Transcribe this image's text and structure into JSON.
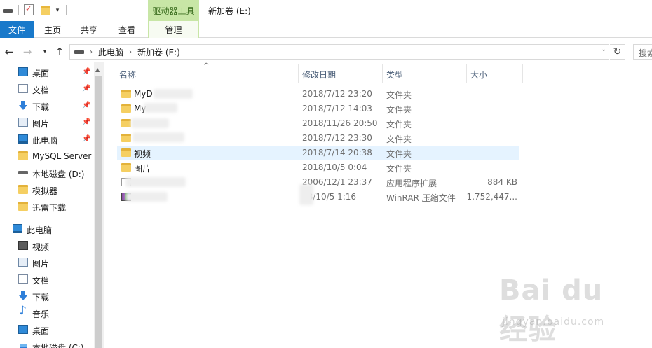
{
  "window": {
    "title": "新加卷 (E:)",
    "context_tab_header": "驱动器工具"
  },
  "quick_access": {
    "items": [
      "drive-icon",
      "properties-icon",
      "new-folder-icon",
      "customize-dropdown-icon"
    ]
  },
  "ribbon": {
    "tabs": {
      "file": "文件",
      "home": "主页",
      "share": "共享",
      "view": "查看",
      "manage": "管理"
    },
    "active_color": "#1979ca",
    "context_color": "#c8e6a6"
  },
  "address": {
    "crumbs": [
      "此电脑",
      "新加卷 (E:)"
    ],
    "search_placeholder": "搜索"
  },
  "sidebar": {
    "quick_access": [
      {
        "label": "桌面",
        "icon": "desktop-icon",
        "pinned": true
      },
      {
        "label": "文档",
        "icon": "documents-icon",
        "pinned": true
      },
      {
        "label": "下载",
        "icon": "download-icon",
        "pinned": true
      },
      {
        "label": "图片",
        "icon": "pictures-icon",
        "pinned": true
      },
      {
        "label": "此电脑",
        "icon": "this-pc-icon",
        "pinned": true
      },
      {
        "label": "MySQL Server",
        "icon": "folder-icon",
        "pinned": false
      },
      {
        "label": "本地磁盘 (D:)",
        "icon": "drive-icon",
        "pinned": false
      },
      {
        "label": "模拟器",
        "icon": "folder-icon",
        "pinned": false
      },
      {
        "label": "迅雷下载",
        "icon": "folder-icon",
        "pinned": false
      }
    ],
    "this_pc": {
      "label": "此电脑",
      "items": [
        {
          "label": "视频",
          "icon": "video-icon"
        },
        {
          "label": "图片",
          "icon": "pictures-icon"
        },
        {
          "label": "文档",
          "icon": "documents-icon"
        },
        {
          "label": "下载",
          "icon": "download-icon"
        },
        {
          "label": "音乐",
          "icon": "music-icon"
        },
        {
          "label": "桌面",
          "icon": "desktop-icon"
        },
        {
          "label": "本地磁盘 (C:)",
          "icon": "windows-drive-icon"
        }
      ]
    }
  },
  "columns": {
    "name": "名称",
    "date": "修改日期",
    "type": "类型",
    "size": "大小"
  },
  "files": [
    {
      "name": "MyD",
      "date": "2018/7/12 23:20",
      "type": "文件夹",
      "size": "",
      "icon": "folder-icon",
      "selected": false
    },
    {
      "name": "My",
      "date": "2018/7/12 14:03",
      "type": "文件夹",
      "size": "",
      "icon": "folder-icon",
      "selected": false
    },
    {
      "name": "",
      "date": "2018/11/26 20:50",
      "type": "文件夹",
      "size": "",
      "icon": "folder-icon",
      "selected": false
    },
    {
      "name": "",
      "date": "2018/7/12 23:30",
      "type": "文件夹",
      "size": "",
      "icon": "folder-icon",
      "selected": false
    },
    {
      "name": "视频",
      "date": "2018/7/14 20:38",
      "type": "文件夹",
      "size": "",
      "icon": "folder-icon",
      "selected": true
    },
    {
      "name": "图片",
      "date": "2018/10/5 0:04",
      "type": "文件夹",
      "size": "",
      "icon": "folder-icon",
      "selected": false
    },
    {
      "name": "",
      "date": "2006/12/1 23:37",
      "type": "应用程序扩展",
      "size": "884 KB",
      "icon": "dll-icon",
      "selected": false
    },
    {
      "name": "",
      "date": "18/10/5 1:16",
      "type": "WinRAR 压缩文件",
      "size": "1,752,447...",
      "icon": "winrar-icon",
      "selected": false
    }
  ],
  "watermark": {
    "logo": "Bai du 经验",
    "url": "jingyan.baidu.com"
  }
}
